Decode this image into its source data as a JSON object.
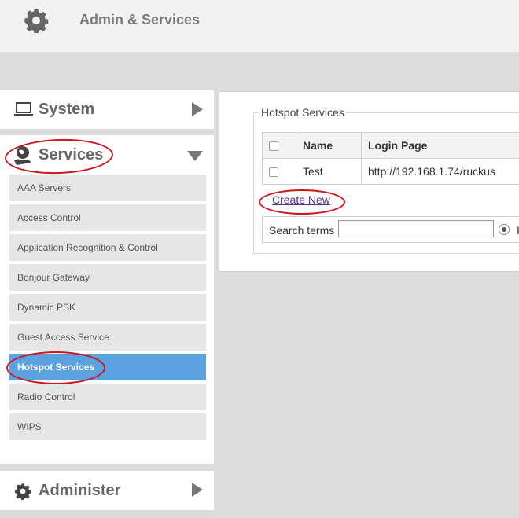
{
  "header": {
    "title": "Admin & Services",
    "icon": "gear-icon"
  },
  "sidebar": {
    "system": {
      "label": "System",
      "icon": "laptop-icon"
    },
    "services": {
      "label": "Services",
      "icon": "services-globe-hand-icon",
      "items": [
        {
          "label": "AAA Servers"
        },
        {
          "label": "Access Control"
        },
        {
          "label": "Application Recognition & Control"
        },
        {
          "label": "Bonjour Gateway"
        },
        {
          "label": "Dynamic PSK"
        },
        {
          "label": "Guest Access Service"
        },
        {
          "label": "Hotspot Services",
          "active": true
        },
        {
          "label": "Radio Control"
        },
        {
          "label": "WIPS"
        }
      ]
    },
    "administer": {
      "label": "Administer",
      "icon": "gear-icon"
    }
  },
  "main": {
    "section_title": "Hotspot Services",
    "table": {
      "headers": [
        "",
        "Name",
        "Login Page"
      ],
      "rows": [
        {
          "name": "Test",
          "login_page": "http://192.168.1.74/ruckus"
        }
      ]
    },
    "create_new_label": "Create New",
    "search": {
      "label": "Search terms",
      "value": "",
      "trailing_text": "I"
    }
  },
  "colors": {
    "active": "#5ba3e0",
    "annotation": "#d0141b",
    "link": "#5a2e8c"
  }
}
